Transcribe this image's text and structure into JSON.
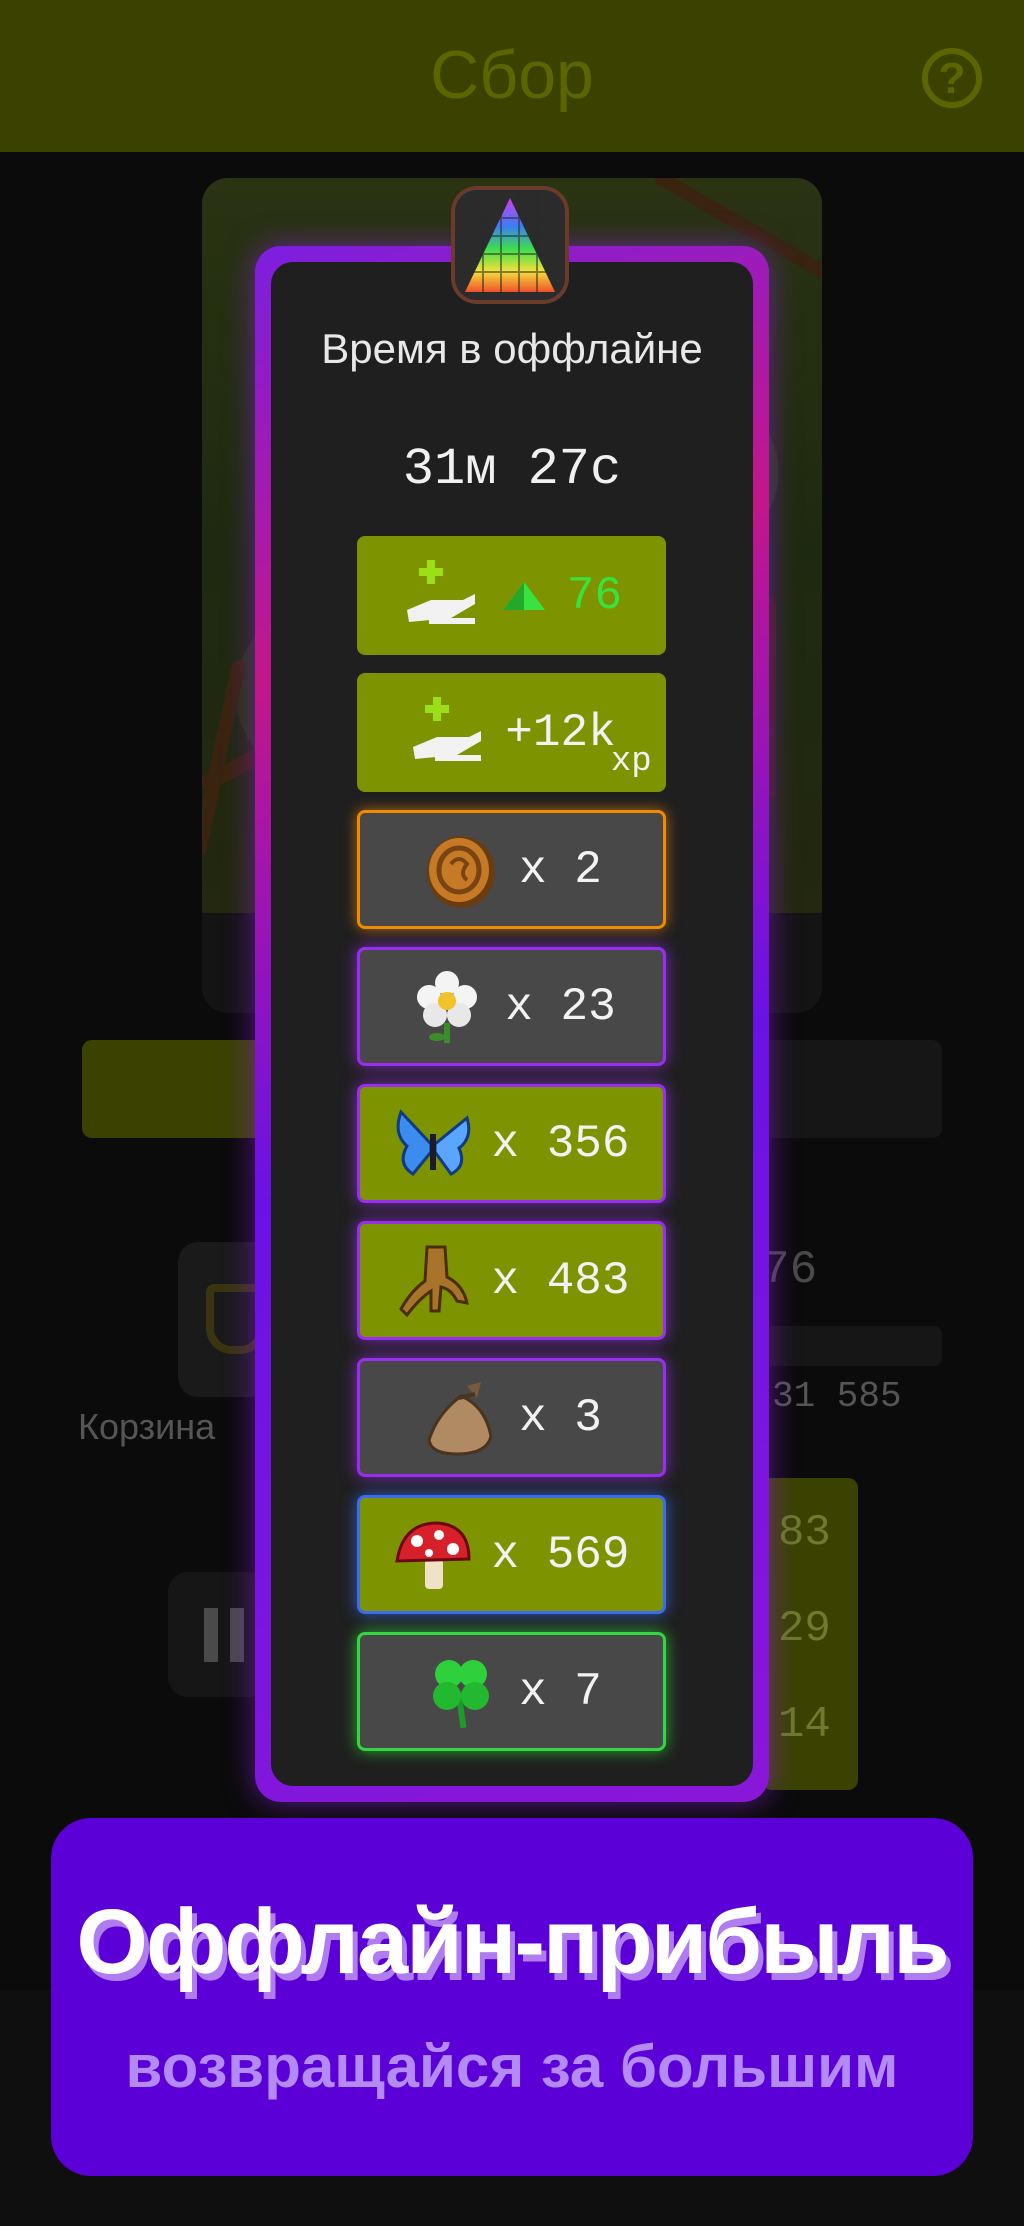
{
  "header": {
    "title": "Сбор",
    "help_label": "?"
  },
  "background": {
    "collect_progress": 0.62,
    "value_right": "76",
    "basket_label": "Корзина",
    "total_value": "31 585",
    "stats": [
      "83",
      "29",
      "14"
    ]
  },
  "modal": {
    "title": "Время в оффлайне",
    "time": "31м 27с",
    "rewards": [
      {
        "icon": "green-crystal-gain-icon",
        "text": "76",
        "style": "green"
      },
      {
        "icon": "xp-gain-icon",
        "text": "+12k",
        "suffix": "xp",
        "style": "green"
      },
      {
        "icon": "bronze-coin-icon",
        "text": "x 2",
        "style": "gray",
        "glow": "orange"
      },
      {
        "icon": "daisy-flower-icon",
        "text": "x 23",
        "style": "gray",
        "glow": "purple"
      },
      {
        "icon": "blue-butterfly-icon",
        "text": "x 356",
        "style": "green",
        "glow": "purple"
      },
      {
        "icon": "tree-root-icon",
        "text": "x 483",
        "style": "green",
        "glow": "purple"
      },
      {
        "icon": "seed-sack-icon",
        "text": "x 3",
        "style": "gray",
        "glow": "purple"
      },
      {
        "icon": "red-mushroom-icon",
        "text": "x 569",
        "style": "green",
        "glow": "blue"
      },
      {
        "icon": "four-leaf-clover-icon",
        "text": "x 7",
        "style": "gray",
        "glow": "green"
      }
    ]
  },
  "promo": {
    "title": "Оффлайн-прибыль",
    "subtitle": "возвращайся за большим"
  },
  "colors": {
    "accent_green": "#7d9400",
    "modal_purple": "#7b1fe0",
    "banner_purple": "#5b00d6",
    "crystal_green": "#39e23f"
  }
}
